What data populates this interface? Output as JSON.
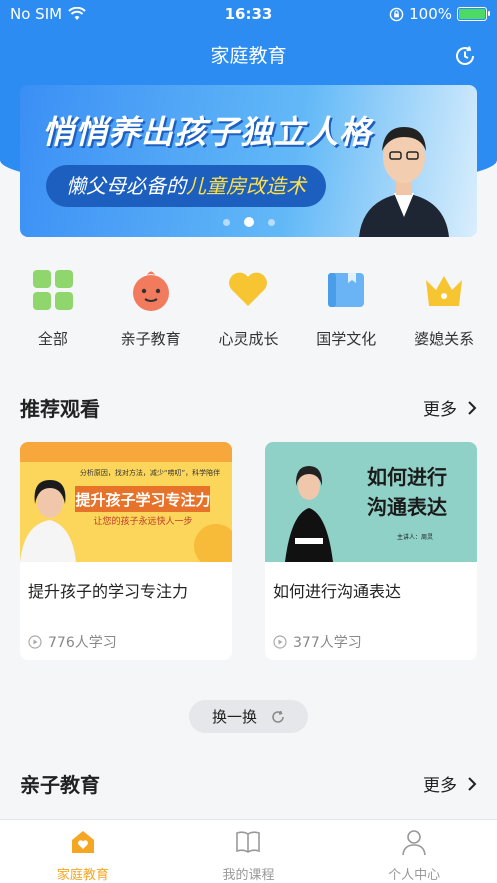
{
  "status": {
    "carrier": "No SIM",
    "time": "16:33",
    "battery": "100%"
  },
  "header": {
    "title": "家庭教育"
  },
  "banner": {
    "headline": "悄悄养出孩子独立人格",
    "sub_prefix": "懒父母必备的",
    "sub_highlight": "儿童房改造术",
    "page_count": 3,
    "active_page": 2
  },
  "categories": [
    {
      "label": "全部",
      "icon": "grid-icon"
    },
    {
      "label": "亲子教育",
      "icon": "baby-face-icon"
    },
    {
      "label": "心灵成长",
      "icon": "heart-icon"
    },
    {
      "label": "国学文化",
      "icon": "book-icon"
    },
    {
      "label": "婆媳关系",
      "icon": "crown-icon"
    }
  ],
  "recommend": {
    "title": "推荐观看",
    "more": "更多",
    "cards": [
      {
        "title": "提升孩子的学习专注力",
        "learners": "776人学习",
        "thumb_top": "分析原因，找对方法，减少“唠叨”，科学陪伴",
        "thumb_main": "提升孩子学习专注力",
        "thumb_sub": "让您的孩子永远快人一步"
      },
      {
        "title": "如何进行沟通表达",
        "learners": "377人学习",
        "thumb_main1": "如何进行",
        "thumb_main2": "沟通表达",
        "thumb_speaker": "主讲人：周灵"
      }
    ]
  },
  "shuffle": {
    "label": "换一换"
  },
  "parenting": {
    "title": "亲子教育",
    "more": "更多"
  },
  "tabs": [
    {
      "label": "家庭教育",
      "active": true
    },
    {
      "label": "我的课程",
      "active": false
    },
    {
      "label": "个人中心",
      "active": false
    }
  ],
  "colors": {
    "primary": "#2d8cf2",
    "tab_active": "#f5a623"
  }
}
